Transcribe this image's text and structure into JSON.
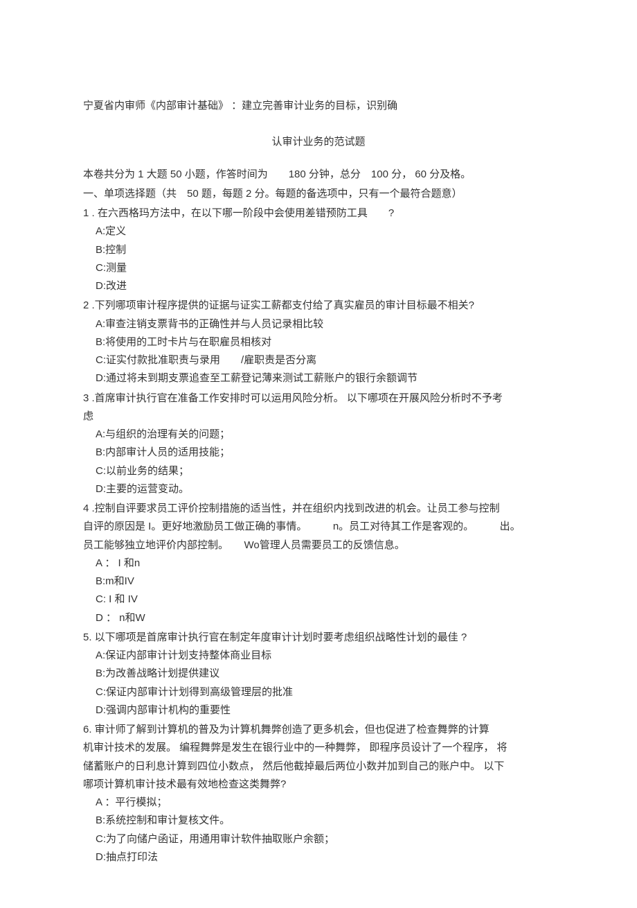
{
  "title_part1": "宁夏省内审师《内部审计基础》 ：建立完善审计业务的目标，识别确",
  "title_part2": "认审计业务的范试题",
  "intro": "本卷共分为  1 大题  50 小题，作答时间为　　180 分钟，总分　100 分，  60 分及格。",
  "section_header": "一、单项选择题（共　50 题，每题 2 分。每题的备选项中，只有一个最符合题意）",
  "questions": [
    {
      "stem": [
        "1 . 在六西格玛方法中，在以下哪一阶段中会使用差错预防工具　　?"
      ],
      "options": [
        "A:定义",
        "B:控制",
        "C:测量",
        "D:改进"
      ]
    },
    {
      "stem": [
        "2 .下列哪项审计程序提供的证据与证实工薪都支付给了真实雇员的审计目标最不相关?"
      ],
      "options": [
        "A:审查注销支票背书的正确性并与人员记录相比较",
        "B:将使用的工时卡片与在职雇员相核对",
        "C:证实付款批准职责与录用　　/雇职责是否分离",
        "D:通过将未到期支票追查至工薪登记薄来测试工薪账户的银行余额调节"
      ]
    },
    {
      "stem": [
        "3 .首席审计执行官在准备工作安排时可以运用风险分析。  以下哪项在开展风险分析时不予考",
        "虑"
      ],
      "options": [
        "A:与组织的治理有关的问题；",
        "B:内部审计人员的适用技能；",
        "C:以前业务的结果；",
        "D:主要的运营变动。"
      ]
    },
    {
      "stem": [
        "4 .控制自评要求员工评价控制措施的适当性，并在组织内找到改进的机会。让员工参与控制",
        "自评的原因是  I。更好地激励员工做正确的事情。　　　n。员工对待其工作是客观的。　　　出。",
        "员工能够独立地评价内部控制。　　Wo管理人员需要员工的反馈信息。"
      ],
      "options": [
        "A ： I 和n",
        "B:m和IV",
        "C: I 和  IV",
        "D ： n和W"
      ]
    },
    {
      "stem": [
        "5.  以下哪项是首席审计执行官在制定年度审计计划时要考虑组织战略性计划的最佳  ?"
      ],
      "options": [
        "A:保证内部审计计划支持整体商业目标",
        "B:为改善战略计划提供建议",
        "C:保证内部审计计划得到高级管理层的批准",
        "D:强调内部审计机构的重要性"
      ]
    },
    {
      "stem": [
        "6.  审计师了解到计算机的普及为计算机舞弊创造了更多机会，但也促进了检查舞弊的计算",
        "机审计技术的发展。 编程舞弊是发生在银行业中的一种舞弊， 即程序员设计了一个程序， 将",
        "储蓄账户的日利息计算到四位小数点， 然后他截掉最后两位小数并加到自己的账户中。 以下",
        "哪项计算机审计技术最有效地检查这类舞弊?"
      ],
      "options": [
        "A ：平行模拟；",
        "B:系统控制和审计复核文件。",
        "C:为了向储户函证，用通用审计软件抽取账户余额；",
        "D:抽点打印法"
      ]
    }
  ]
}
